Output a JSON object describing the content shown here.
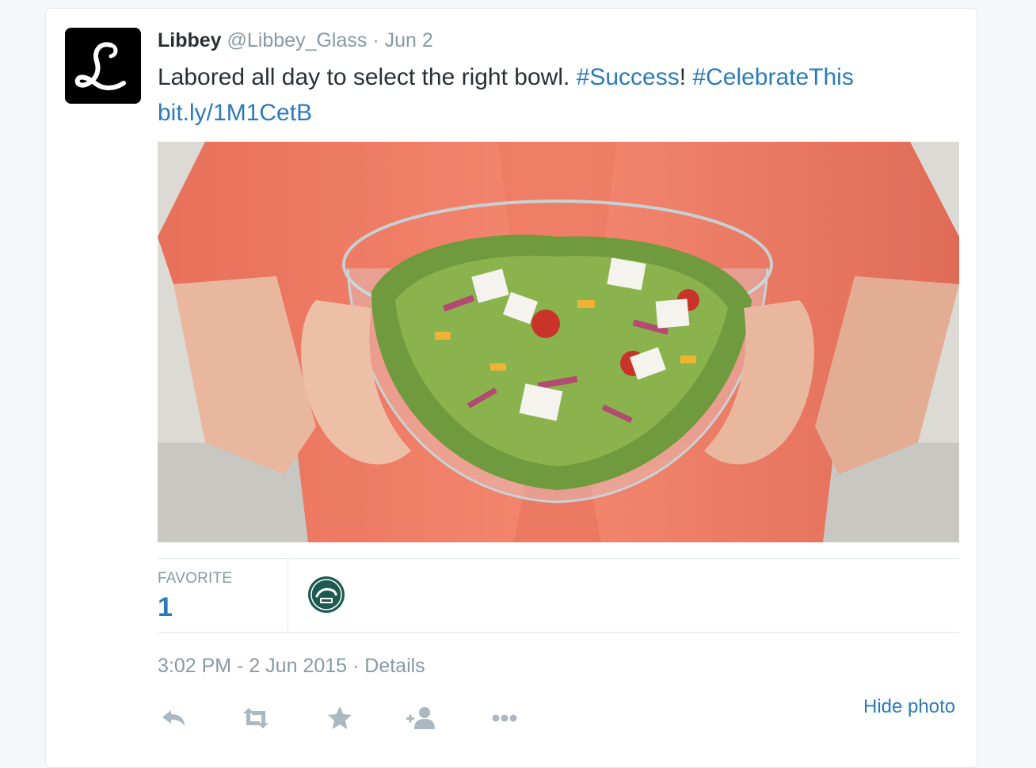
{
  "tweet": {
    "author_name": "Libbey",
    "author_handle": "@Libbey_Glass",
    "separator": "·",
    "date": "Jun 2",
    "text_parts": {
      "main": "Labored all day to select the right bowl. ",
      "hashtag1": "#Success",
      "bang": "! ",
      "hashtag2": "#CelebrateThis",
      "link": "bit.ly/1M1CetB"
    },
    "photo_alt": "Woman in coral top holding a glass bowl of salad"
  },
  "stats": {
    "label": "FAVORITE",
    "count": "1"
  },
  "meta": {
    "timestamp": "3:02 PM - 2 Jun 2015",
    "separator": " · ",
    "details": "Details"
  },
  "actions": {
    "hide_photo": "Hide photo",
    "icons": [
      "reply-icon",
      "retweet-icon",
      "favorite-star-icon",
      "follow-icon",
      "more-icon"
    ]
  },
  "colors": {
    "link": "#2b7bb9",
    "muted": "#8899a6",
    "text": "#292f33",
    "shirt": "#f0826b",
    "action_icon": "#aab8c2"
  }
}
